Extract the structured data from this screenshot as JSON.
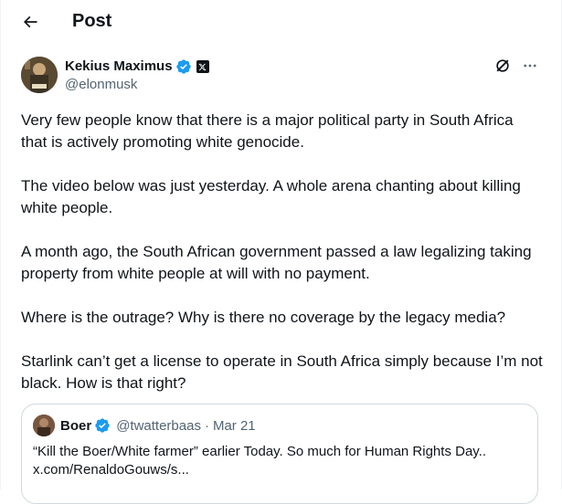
{
  "header": {
    "back_icon": "arrow-left-icon",
    "title": "Post"
  },
  "post": {
    "author": {
      "display_name": "Kekius Maximus",
      "handle": "@elonmusk",
      "verified_color": "#1d9bf0",
      "affiliation_badge": "x-logo-icon"
    },
    "actions": [
      "grok-icon",
      "more-icon"
    ],
    "paragraphs": [
      "Very few people know that there is a major political party in South Africa that is actively promoting white genocide.",
      "The video below was just yesterday. A whole arena chanting about killing white people.",
      "A month ago, the South African government passed a law legalizing taking property from white people at will with no payment.",
      "Where is the outrage? Why is there no coverage by the legacy media?",
      "Starlink can’t get a license to operate in South Africa simply because I’m not black. How is that right?"
    ],
    "quote": {
      "display_name": "Boer",
      "handle": "@twatterbaas",
      "separator": "·",
      "date": "Mar 21",
      "text_line1": "“Kill the Boer/White farmer” earlier Today. So much for Human Rights Day..",
      "text_line2": "x.com/RenaldoGouws/s..."
    }
  }
}
